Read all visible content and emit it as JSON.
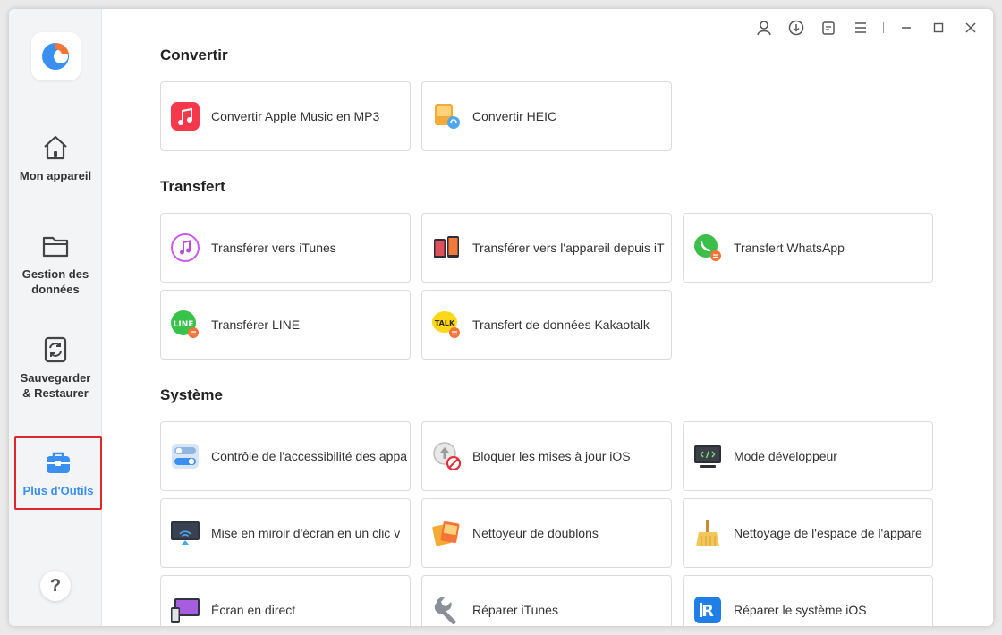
{
  "window": {
    "toolbar": [
      "user-icon",
      "download-icon",
      "feedback-icon",
      "menu-icon",
      "minimize-icon",
      "maximize-icon",
      "close-icon"
    ]
  },
  "sidebar": {
    "items": [
      {
        "label": "Mon appareil",
        "icon": "home-icon"
      },
      {
        "label": "Gestion des données",
        "icon": "folder-icon"
      },
      {
        "label": "Sauvegarder & Restaurer",
        "icon": "backup-icon"
      },
      {
        "label": "Plus d'Outils",
        "icon": "toolbox-icon",
        "active": true
      }
    ],
    "help": "?"
  },
  "sections": {
    "convertir": {
      "title": "Convertir",
      "items": [
        {
          "label": "Convertir Apple Music en MP3",
          "icon": "apple-music-icon"
        },
        {
          "label": "Convertir HEIC",
          "icon": "heic-icon"
        }
      ]
    },
    "transfert": {
      "title": "Transfert",
      "items": [
        {
          "label": "Transférer vers iTunes",
          "icon": "itunes-icon"
        },
        {
          "label": "Transférer vers l'appareil depuis iT",
          "icon": "phone-transfer-icon"
        },
        {
          "label": "Transfert WhatsApp",
          "icon": "whatsapp-icon"
        },
        {
          "label": "Transférer LINE",
          "icon": "line-icon"
        },
        {
          "label": "Transfert de données Kakaotalk",
          "icon": "kakaotalk-icon"
        }
      ]
    },
    "systeme": {
      "title": "Système",
      "items": [
        {
          "label": "Contrôle de l'accessibilité des appa",
          "icon": "toggle-icon"
        },
        {
          "label": "Bloquer les mises à jour iOS",
          "icon": "block-update-icon"
        },
        {
          "label": "Mode développeur",
          "icon": "developer-icon"
        },
        {
          "label": "Mise en miroir d'écran en un clic v",
          "icon": "screen-mirror-icon"
        },
        {
          "label": "Nettoyeur de doublons",
          "icon": "duplicate-icon"
        },
        {
          "label": "Nettoyage de l'espace de l'appare",
          "icon": "broom-icon"
        },
        {
          "label": "Écran en direct",
          "icon": "live-screen-icon"
        },
        {
          "label": "Réparer iTunes",
          "icon": "wrench-icon"
        },
        {
          "label": "Réparer le système iOS",
          "icon": "ios-repair-icon"
        }
      ]
    }
  },
  "colors": {
    "accent": "#3b8ff0",
    "active_border": "#e0262b"
  }
}
